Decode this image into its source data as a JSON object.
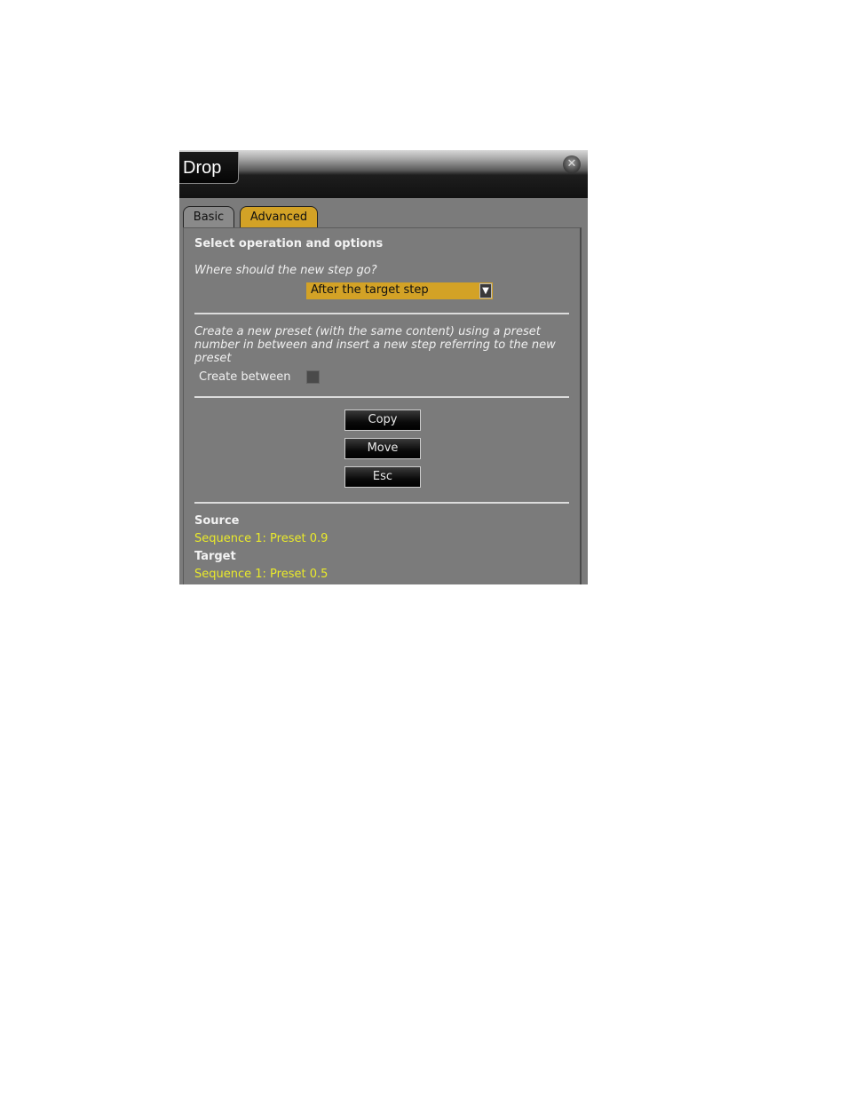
{
  "window": {
    "title": "Drop",
    "close_icon": "close-icon"
  },
  "tabs": [
    {
      "label": "Basic",
      "active": false
    },
    {
      "label": "Advanced",
      "active": true
    }
  ],
  "main": {
    "section_title": "Select operation and options",
    "question": "Where should the new step go?",
    "position_select": {
      "value": "After the target step"
    },
    "create_between_description": "Create a new preset (with the same content) using a preset number in between and insert a new step referring to the new preset",
    "create_between_label": "Create between",
    "create_between_checked": false,
    "buttons": {
      "copy": "Copy",
      "move": "Move",
      "esc": "Esc"
    },
    "source_label": "Source",
    "source_value": "Sequence 1: Preset 0.9",
    "target_label": "Target",
    "target_value": "Sequence 1: Preset 0.5"
  },
  "colors": {
    "accent": "#d3a226",
    "value_text": "#eaea2a",
    "panel_bg": "#7b7b7b"
  }
}
